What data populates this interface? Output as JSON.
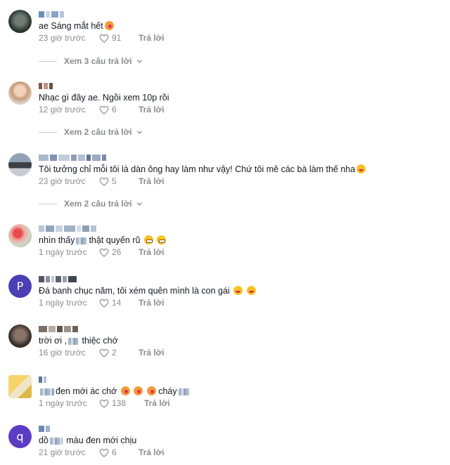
{
  "comments": [
    {
      "text": "ae Sáng mắt hết",
      "time": "23 giờ trước",
      "likes": "91",
      "reply": "Trả lời",
      "view_replies": "Xem 3 câu trả lời"
    },
    {
      "text": "Nhạc gì đây ae. Ngồi xem 10p rồi",
      "time": "12 giờ trước",
      "likes": "6",
      "reply": "Trả lời",
      "view_replies": "Xem 2 câu trả lời"
    },
    {
      "text": "Tôi tưởng chỉ mỗi tôi là dàn ông hay làm như vậy! Chứ tôi mê các bà làm thế nha",
      "time": "23 giờ trước",
      "likes": "5",
      "reply": "Trả lời",
      "view_replies": "Xem 2 câu trả lời"
    },
    {
      "text_a": "nhìn thấy",
      "text_b": "thật quyến rũ",
      "time": "1 ngày trước",
      "likes": "26",
      "reply": "Trả lời"
    },
    {
      "avatar_letter": "P",
      "text": "Đá banh chục năm, tôi xém quên mình là con gái",
      "time": "1 ngày trước",
      "likes": "14",
      "reply": "Trả lời"
    },
    {
      "text_a": "trời ơi ,",
      "text_b": "thiệc chớ",
      "time": "16 giờ trước",
      "likes": "2",
      "reply": "Trả lời"
    },
    {
      "text_a": "đen mới ác chớ",
      "text_b": "cháy",
      "time": "1 ngày trước",
      "likes": "138",
      "reply": "Trả lời"
    },
    {
      "avatar_letter": "q",
      "text_a": "dồ",
      "text_b": "màu đen mới chịu",
      "time": "21 giờ trước",
      "likes": "6",
      "reply": "Trả lời"
    }
  ],
  "colors": {
    "text": "#161823",
    "muted": "#8a8b91",
    "avatar_p": "#4b3fb5",
    "avatar_q": "#5b3cc4"
  },
  "icons": {
    "like": "heart-outline-icon",
    "expand": "chevron-down-icon"
  }
}
